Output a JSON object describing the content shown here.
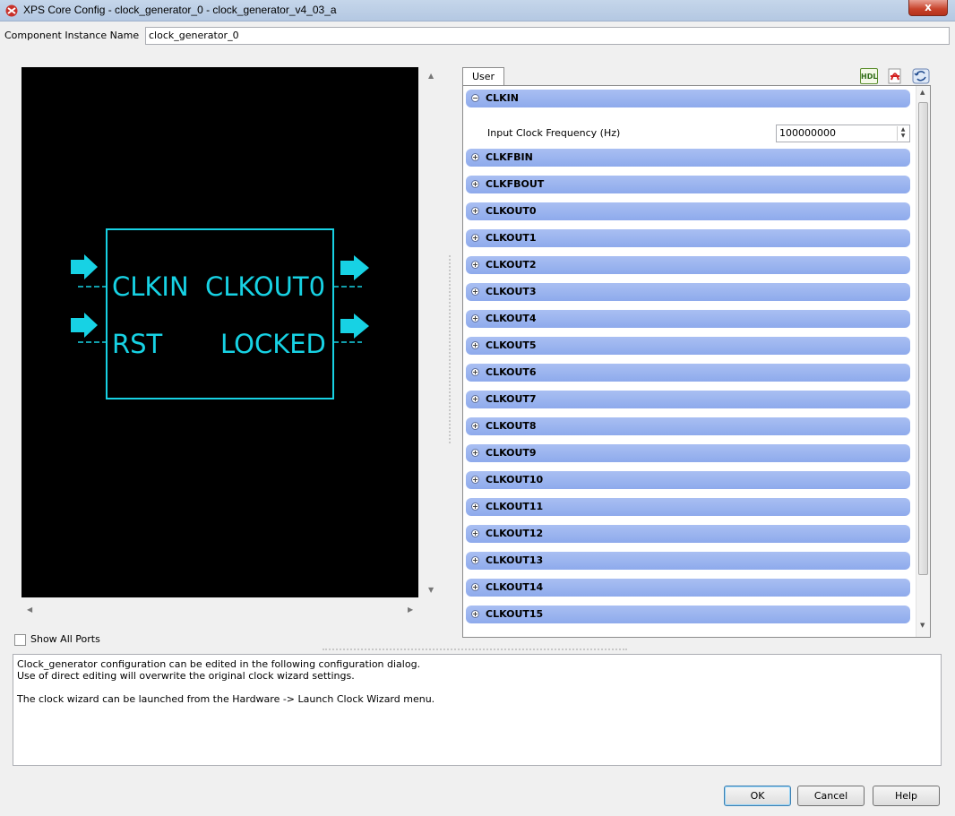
{
  "window": {
    "title": "XPS Core Config - clock_generator_0 - clock_generator_v4_03_a",
    "close_glyph": "x",
    "icon": "xilinx-logo-icon"
  },
  "instance": {
    "label": "Component Instance Name",
    "value": "clock_generator_0"
  },
  "symbol": {
    "left_ports": [
      "CLKIN",
      "RST"
    ],
    "right_ports": [
      "CLKOUT0",
      "LOCKED"
    ],
    "color": "#17d2e4",
    "background": "#000000"
  },
  "show_all_ports": {
    "label": "Show All Ports",
    "checked": false
  },
  "tabs": [
    {
      "label": "User",
      "active": true
    }
  ],
  "toolbar": {
    "hdl_label": "HDL",
    "pdf_icon": "pdf-datasheet-icon",
    "restore_icon": "restore-defaults-icon"
  },
  "groups": [
    {
      "label": "CLKIN",
      "expanded": true
    },
    {
      "label": "CLKFBIN",
      "expanded": false
    },
    {
      "label": "CLKFBOUT",
      "expanded": false
    },
    {
      "label": "CLKOUT0",
      "expanded": false
    },
    {
      "label": "CLKOUT1",
      "expanded": false
    },
    {
      "label": "CLKOUT2",
      "expanded": false
    },
    {
      "label": "CLKOUT3",
      "expanded": false
    },
    {
      "label": "CLKOUT4",
      "expanded": false
    },
    {
      "label": "CLKOUT5",
      "expanded": false
    },
    {
      "label": "CLKOUT6",
      "expanded": false
    },
    {
      "label": "CLKOUT7",
      "expanded": false
    },
    {
      "label": "CLKOUT8",
      "expanded": false
    },
    {
      "label": "CLKOUT9",
      "expanded": false
    },
    {
      "label": "CLKOUT10",
      "expanded": false
    },
    {
      "label": "CLKOUT11",
      "expanded": false
    },
    {
      "label": "CLKOUT12",
      "expanded": false
    },
    {
      "label": "CLKOUT13",
      "expanded": false
    },
    {
      "label": "CLKOUT14",
      "expanded": false
    },
    {
      "label": "CLKOUT15",
      "expanded": false
    }
  ],
  "clkin_param": {
    "label": "Input Clock Frequency (Hz)",
    "value": "100000000"
  },
  "description": [
    "Clock_generator configuration can be edited in the following configuration dialog.",
    "Use of direct editing will overwrite the original clock wizard settings.",
    "",
    "The clock wizard can be launched from the Hardware -> Launch Clock Wizard menu."
  ],
  "buttons": {
    "ok": "OK",
    "cancel": "Cancel",
    "help": "Help"
  },
  "colors": {
    "group_header": "#9bb4ef",
    "titlebar": "#bdd0e8"
  }
}
